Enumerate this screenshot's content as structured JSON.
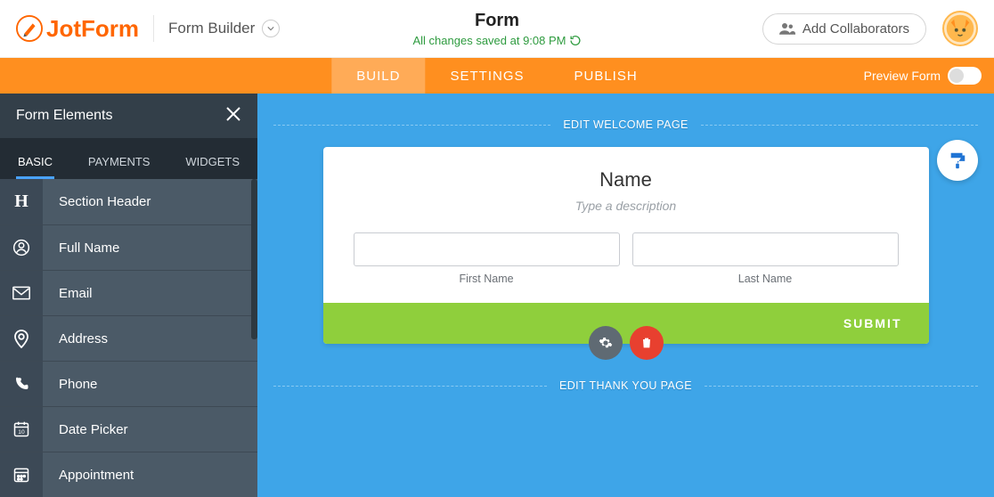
{
  "brand": {
    "name": "JotForm",
    "builder_label": "Form Builder"
  },
  "header": {
    "title": "Form",
    "save_status": "All changes saved at 9:08 PM",
    "collaborators_label": "Add Collaborators"
  },
  "nav": {
    "tabs": [
      {
        "label": "BUILD",
        "active": true
      },
      {
        "label": "SETTINGS",
        "active": false
      },
      {
        "label": "PUBLISH",
        "active": false
      }
    ],
    "preview_label": "Preview Form"
  },
  "sidebar": {
    "title": "Form Elements",
    "tabs": [
      {
        "label": "BASIC",
        "active": true
      },
      {
        "label": "PAYMENTS",
        "active": false
      },
      {
        "label": "WIDGETS",
        "active": false
      }
    ],
    "items": [
      {
        "icon": "heading-icon",
        "label": "Section Header"
      },
      {
        "icon": "person-icon",
        "label": "Full Name"
      },
      {
        "icon": "email-icon",
        "label": "Email"
      },
      {
        "icon": "location-icon",
        "label": "Address"
      },
      {
        "icon": "phone-icon",
        "label": "Phone"
      },
      {
        "icon": "calendar-icon",
        "label": "Date Picker"
      },
      {
        "icon": "schedule-icon",
        "label": "Appointment"
      }
    ]
  },
  "canvas": {
    "welcome_hint": "EDIT WELCOME PAGE",
    "thank_hint": "EDIT THANK YOU PAGE",
    "form": {
      "title": "Name",
      "description_placeholder": "Type a description",
      "first_name_label": "First Name",
      "last_name_label": "Last Name",
      "submit_label": "SUBMIT"
    }
  }
}
